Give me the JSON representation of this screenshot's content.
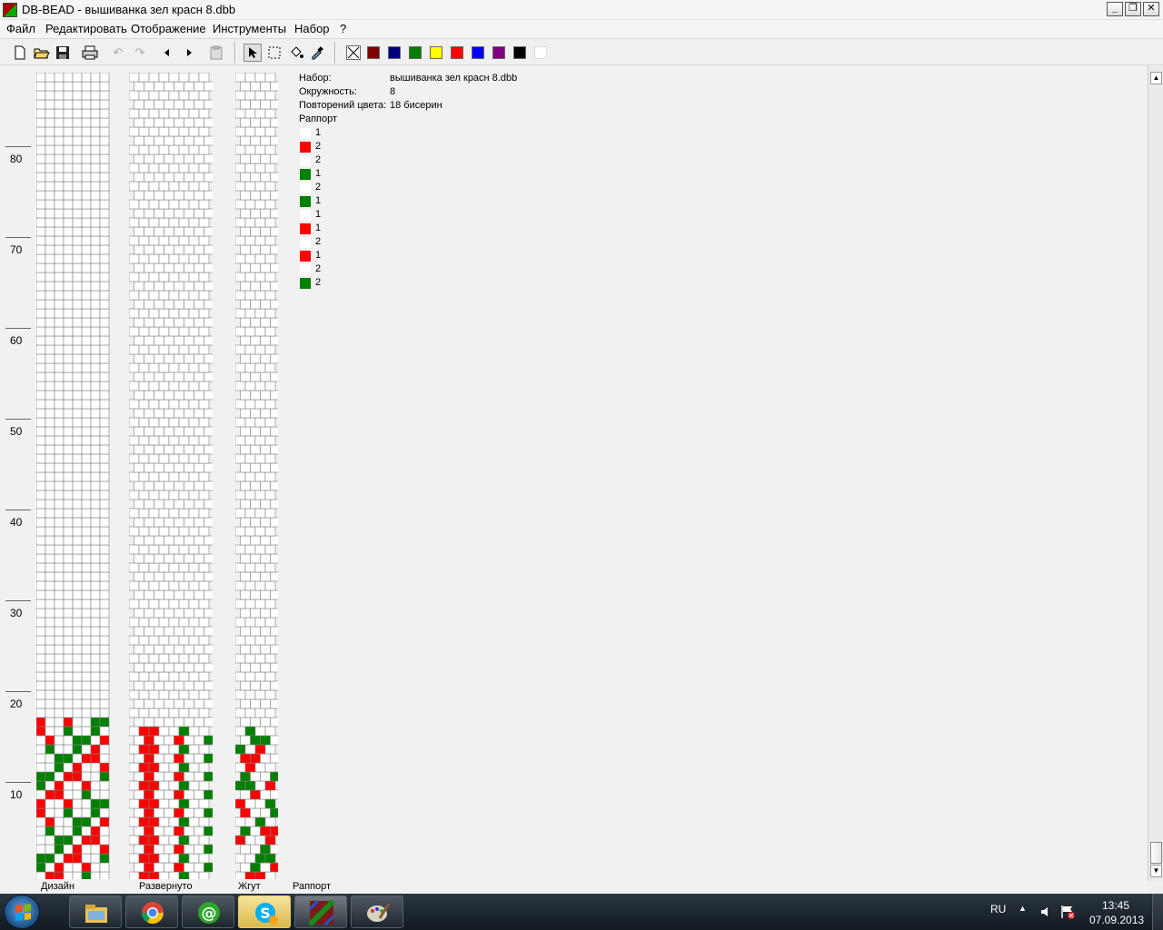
{
  "window": {
    "title": "DB-BEAD - вышиванка зел красн 8.dbb",
    "controls": {
      "minimize": "_",
      "restore": "❐",
      "close": "✕"
    }
  },
  "menu": [
    "Файл",
    "Редактировать",
    "Отображение",
    "Инструменты",
    "Набор",
    "?"
  ],
  "toolbar": {
    "tools": [
      "new-file-icon",
      "open-folder-icon",
      "save-icon",
      "print-icon",
      "undo-icon",
      "redo-icon",
      "arrow-left-icon",
      "arrow-right-icon",
      "clipboard-icon",
      "pointer-icon",
      "select-rect-icon",
      "fill-bucket-icon",
      "eyedropper-icon"
    ],
    "palette": [
      {
        "name": "none",
        "color": "none"
      },
      {
        "name": "dark-red",
        "color": "#800000"
      },
      {
        "name": "navy",
        "color": "#000080"
      },
      {
        "name": "green",
        "color": "#008000"
      },
      {
        "name": "yellow",
        "color": "#ffff00"
      },
      {
        "name": "red",
        "color": "#ff0000"
      },
      {
        "name": "blue",
        "color": "#0000ff"
      },
      {
        "name": "purple",
        "color": "#800080"
      },
      {
        "name": "black",
        "color": "#000000"
      },
      {
        "name": "white",
        "color": "#ffffff"
      }
    ]
  },
  "ruler": {
    "labels": [
      "80",
      "70",
      "60",
      "50",
      "40",
      "30",
      "20",
      "10"
    ]
  },
  "panes": {
    "design": "Дизайн",
    "expanded": "Развернуто",
    "rope": "Жгут",
    "rapport": "Раппорт"
  },
  "info": {
    "set_key": "Набор:",
    "set_val": "вышиванка зел красн 8.dbb",
    "circ_key": "Окружность:",
    "circ_val": "8",
    "repeat_key": "Повторений цвета:",
    "repeat_val": "18 бисерин",
    "rapport_key": "Раппорт",
    "rapport": [
      {
        "color": "#ffffff",
        "count": "1"
      },
      {
        "color": "#ff0000",
        "count": "2"
      },
      {
        "color": "#ffffff",
        "count": "2"
      },
      {
        "color": "#008000",
        "count": "1"
      },
      {
        "color": "#ffffff",
        "count": "2"
      },
      {
        "color": "#008000",
        "count": "1"
      },
      {
        "color": "#ffffff",
        "count": "1"
      },
      {
        "color": "#ff0000",
        "count": "1"
      },
      {
        "color": "#ffffff",
        "count": "2"
      },
      {
        "color": "#ff0000",
        "count": "1"
      },
      {
        "color": "#ffffff",
        "count": "2"
      },
      {
        "color": "#008000",
        "count": "2"
      }
    ]
  },
  "taskbar": {
    "apps": [
      "explorer-icon",
      "chrome-icon",
      "mail-agent-icon",
      "skype-icon",
      "db-bead-icon",
      "paint-icon"
    ],
    "lang": "RU",
    "time": "13:45",
    "date": "07.09.2013"
  },
  "colors": {
    "white": "#ffffff",
    "red": "#ff0000",
    "green": "#008000",
    "grid": "#808080"
  }
}
